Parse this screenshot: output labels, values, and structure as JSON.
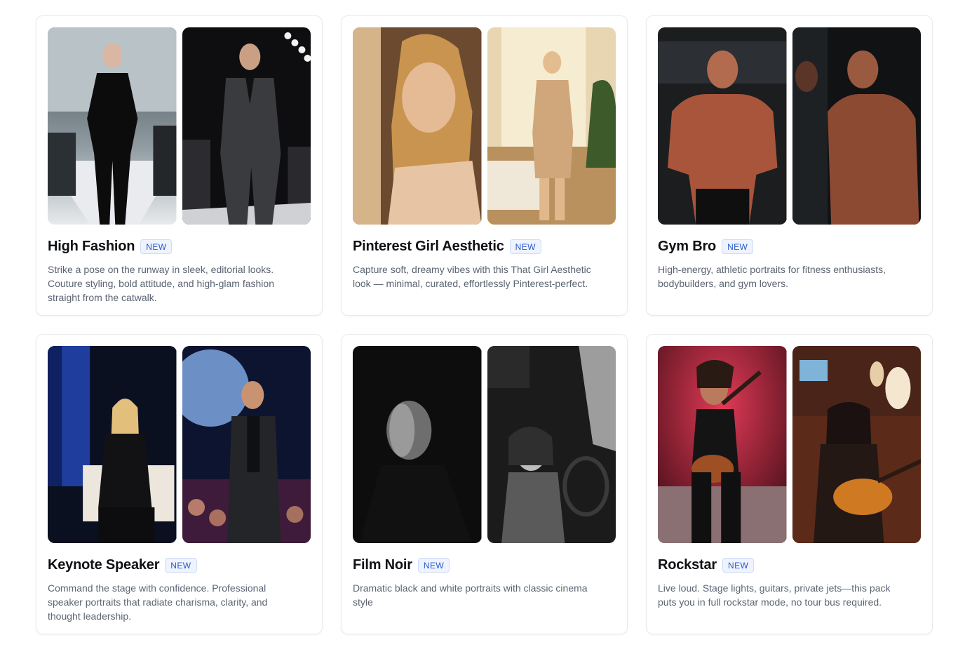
{
  "cards": [
    {
      "title": "High Fashion",
      "badge": "NEW",
      "description": "Strike a pose on the runway in sleek, editorial looks. Couture styling, bold attitude, and high-glam fashion straight from the catwalk.",
      "images": [
        "runway-woman-black-catsuit-photo",
        "runway-man-grey-suit-photo"
      ]
    },
    {
      "title": "Pinterest Girl Aesthetic",
      "badge": "NEW",
      "description": "Capture soft, dreamy vibes with this That Girl Aesthetic look — minimal, curated, effortlessly Pinterest-perfect.",
      "images": [
        "blonde-woman-window-light-photo",
        "woman-mirror-selfie-bedroom-photo"
      ]
    },
    {
      "title": "Gym Bro",
      "badge": "NEW",
      "description": "High-energy, athletic portraits for fitness enthusiasts, bodybuilders, and gym lovers.",
      "images": [
        "muscular-man-flexing-photo",
        "muscular-man-gym-mirror-photo"
      ]
    },
    {
      "title": "Keynote Speaker",
      "badge": "NEW",
      "description": "Command the stage with confidence. Professional speaker portraits that radiate charisma, clarity, and thought leadership.",
      "images": [
        "woman-speaker-stage-chair-photo",
        "man-speaker-audience-photo"
      ]
    },
    {
      "title": "Film Noir",
      "badge": "NEW",
      "description": "Dramatic black and white portraits with classic cinema style",
      "images": [
        "noir-man-portrait-photo",
        "noir-woman-car-photo"
      ]
    },
    {
      "title": "Rockstar",
      "badge": "NEW",
      "description": "Live loud. Stage lights, guitars, private jets—this pack puts you in full rockstar mode, no tour bus required.",
      "images": [
        "rockstar-guitarist-stage-photo",
        "woman-guitar-private-jet-photo"
      ]
    }
  ]
}
